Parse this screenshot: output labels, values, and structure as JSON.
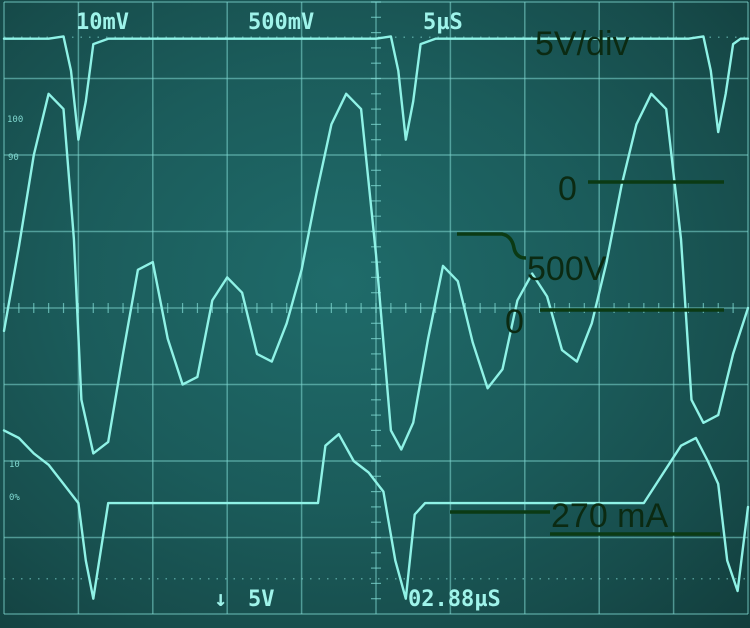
{
  "readouts": {
    "ch1_scale": "10mV",
    "ch2_scale": "500mV",
    "timebase": "5µS",
    "trigger_level": "5V",
    "cursor_time": "02.88µS",
    "trigger_arrow": "↓"
  },
  "side_marks": {
    "ch1_level": "100",
    "ch2_level": "90",
    "ch3_level": "10",
    "ch3_zero": "0%"
  },
  "annotations": {
    "volts_per_div": "5V/div",
    "zero_top": "0",
    "voltage_step": "500V",
    "zero_mid": "0",
    "current_level": "270 mA"
  },
  "colors": {
    "screen": "#1b5c5b",
    "trace": "#8ff2e6",
    "grid": "#7fd9d2",
    "annotation_ink": "#0b2a12"
  },
  "chart_data": {
    "type": "line",
    "title": "",
    "xlabel": "",
    "ylabel": "",
    "x_unit": "µs",
    "xlim": [
      0,
      50
    ],
    "grid": {
      "divisions_x": 10,
      "divisions_y": 8,
      "minor_ticks_per_div": 5,
      "graticule": "on"
    },
    "series": [
      {
        "name": "",
        "x": [
          0,
          3.0,
          4.0,
          4.5,
          5.0,
          5.5,
          6.0,
          7.0,
          10,
          15,
          21.1,
          25.0,
          26.0,
          26.5,
          27.0,
          27.5,
          28.0,
          29.0,
          35,
          42.1,
          46.0,
          47.0,
          47.5,
          48.0,
          48.5,
          49.0,
          49.5,
          50.0
        ],
        "y": [
          3.52,
          3.52,
          3.55,
          3.1,
          2.2,
          2.7,
          3.45,
          3.52,
          3.52,
          3.52,
          3.52,
          3.52,
          3.55,
          3.1,
          2.2,
          2.7,
          3.45,
          3.52,
          3.52,
          3.52,
          3.52,
          3.55,
          3.1,
          2.3,
          2.8,
          3.45,
          3.52,
          3.52
        ]
      },
      {
        "name": "",
        "x": [
          0,
          1.0,
          2.0,
          3.0,
          4.0,
          4.7,
          5.2,
          6.0,
          7.0,
          8.0,
          9.0,
          10.0,
          11.0,
          12.0,
          13.0,
          14.0,
          15.0,
          16.0,
          17.0,
          18.0,
          19.0,
          20.0,
          21.0,
          22.0,
          23.0,
          24.0,
          25.0,
          26.0,
          26.7,
          27.5,
          28.5,
          29.5,
          30.5,
          31.5,
          32.5,
          33.5,
          34.5,
          35.5,
          36.5,
          37.5,
          38.5,
          39.5,
          40.5,
          41.5,
          42.5,
          43.5,
          44.5,
          45.5,
          46.2,
          47.0,
          48.0,
          49.0,
          50.0
        ],
        "y": [
          -0.3,
          0.8,
          2.0,
          2.8,
          2.6,
          0.9,
          -1.2,
          -1.9,
          -1.75,
          -0.6,
          0.5,
          0.6,
          -0.4,
          -1.0,
          -0.9,
          0.1,
          0.4,
          0.2,
          -0.6,
          -0.7,
          -0.2,
          0.5,
          1.5,
          2.4,
          2.8,
          2.6,
          0.7,
          -1.6,
          -1.85,
          -1.5,
          -0.4,
          0.55,
          0.35,
          -0.45,
          -1.05,
          -0.8,
          0.1,
          0.45,
          0.15,
          -0.55,
          -0.7,
          -0.2,
          0.6,
          1.6,
          2.4,
          2.8,
          2.6,
          0.9,
          -1.2,
          -1.5,
          -1.4,
          -0.6,
          0.0
        ]
      },
      {
        "name": "",
        "x": [
          0,
          1.0,
          2.0,
          3.0,
          4.0,
          5.0,
          5.5,
          6.0,
          7.0,
          8.0,
          10,
          15,
          21.1,
          21.6,
          22.5,
          23.5,
          24.5,
          25.5,
          26.3,
          27.0,
          27.6,
          28.3,
          29.5,
          31,
          35,
          40,
          43,
          45.5,
          46.5,
          47.3,
          48.0,
          48.6,
          49.3,
          50.0
        ],
        "y": [
          -1.6,
          -1.7,
          -1.9,
          -2.05,
          -2.3,
          -2.55,
          -3.3,
          -3.8,
          -2.55,
          -2.55,
          -2.55,
          -2.55,
          -2.55,
          -1.8,
          -1.65,
          -2.0,
          -2.15,
          -2.4,
          -3.3,
          -3.8,
          -2.7,
          -2.55,
          -2.55,
          -2.55,
          -2.55,
          -2.55,
          -2.55,
          -1.8,
          -1.7,
          -2.0,
          -2.3,
          -3.3,
          -3.7,
          -2.6
        ]
      }
    ]
  }
}
